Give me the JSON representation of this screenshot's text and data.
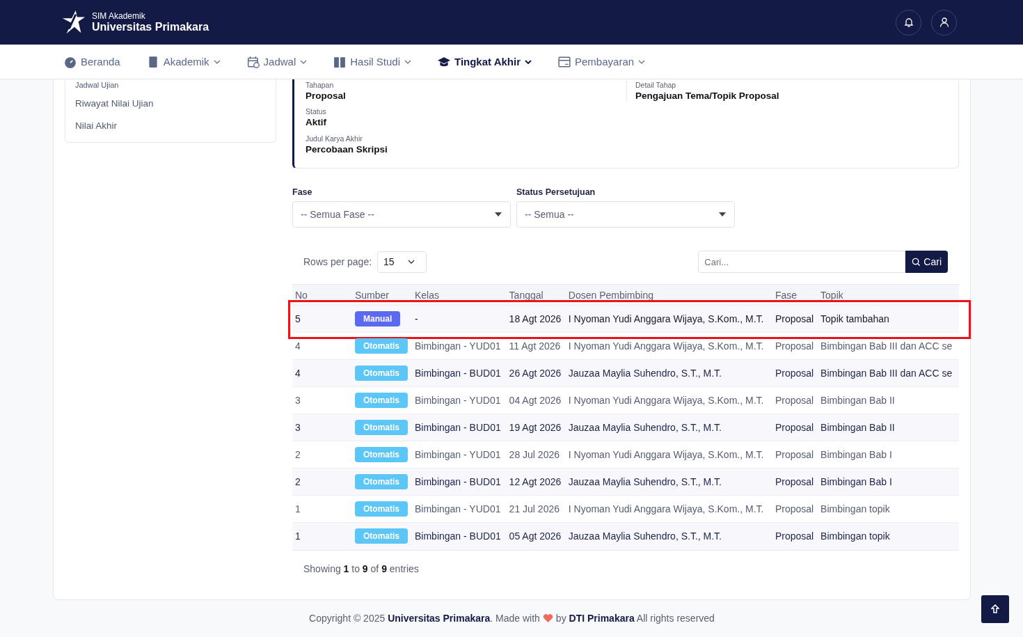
{
  "header": {
    "subtitle": "SIM Akademik",
    "title": "Universitas Primakara"
  },
  "nav": [
    {
      "label": "Beranda",
      "dropdown": false,
      "selected": false
    },
    {
      "label": "Akademik",
      "dropdown": true,
      "selected": false
    },
    {
      "label": "Jadwal",
      "dropdown": true,
      "selected": false
    },
    {
      "label": "Hasil Studi",
      "dropdown": true,
      "selected": false
    },
    {
      "label": "Tingkat Akhir",
      "dropdown": true,
      "selected": true
    },
    {
      "label": "Pembayaran",
      "dropdown": true,
      "selected": false
    }
  ],
  "sidebar": {
    "items": [
      "Jadwal Ujian",
      "Riwayat Nilai Ujian",
      "Nilai Akhir"
    ]
  },
  "info": {
    "fields": [
      {
        "label": "Tahapan",
        "value": "Proposal"
      },
      {
        "label": "Detail Tahap",
        "value": "Pengajuan Tema/Topik Proposal"
      },
      {
        "label": "Status",
        "value": "Aktif"
      },
      {
        "label": "Judul Karya Akhir",
        "value": "Percobaan Skripsi"
      }
    ]
  },
  "filters": [
    {
      "label": "Fase",
      "value": "-- Semua Fase --"
    },
    {
      "label": "Status Persetujuan",
      "value": "-- Semua --"
    }
  ],
  "rows_per_page": {
    "label": "Rows per page:",
    "value": "15"
  },
  "search": {
    "placeholder": "Cari...",
    "button": "Cari"
  },
  "table": {
    "columns": [
      "No",
      "Sumber",
      "Kelas",
      "Tanggal",
      "Dosen Pembimbing",
      "Fase",
      "Topik"
    ],
    "rows": [
      {
        "no": "5",
        "source": {
          "label": "Manual",
          "kind": "manual"
        },
        "kelas": "-",
        "tanggal": "18 Agt 2026",
        "dosen": "I Nyoman Yudi Anggara Wijaya, S.Kom., M.T.",
        "fase": "Proposal",
        "topik": "Topik tambahan",
        "highlighted": true
      },
      {
        "no": "4",
        "source": {
          "label": "Otomatis",
          "kind": "auto"
        },
        "kelas": "Bimbingan - YUD01",
        "tanggal": "11 Agt 2026",
        "dosen": "I Nyoman Yudi Anggara Wijaya, S.Kom., M.T.",
        "fase": "Proposal",
        "topik": "Bimbingan Bab III dan ACC se",
        "highlighted": false
      },
      {
        "no": "4",
        "source": {
          "label": "Otomatis",
          "kind": "auto"
        },
        "kelas": "Bimbingan - BUD01",
        "tanggal": "26 Agt 2026",
        "dosen": "Jauzaa Maylia Suhendro, S.T., M.T.",
        "fase": "Proposal",
        "topik": "Bimbingan Bab III dan ACC se",
        "highlighted": false
      },
      {
        "no": "3",
        "source": {
          "label": "Otomatis",
          "kind": "auto"
        },
        "kelas": "Bimbingan - YUD01",
        "tanggal": "04 Agt 2026",
        "dosen": "I Nyoman Yudi Anggara Wijaya, S.Kom., M.T.",
        "fase": "Proposal",
        "topik": "Bimbingan Bab II",
        "highlighted": false
      },
      {
        "no": "3",
        "source": {
          "label": "Otomatis",
          "kind": "auto"
        },
        "kelas": "Bimbingan - BUD01",
        "tanggal": "19 Agt 2026",
        "dosen": "Jauzaa Maylia Suhendro, S.T., M.T.",
        "fase": "Proposal",
        "topik": "Bimbingan Bab II",
        "highlighted": false
      },
      {
        "no": "2",
        "source": {
          "label": "Otomatis",
          "kind": "auto"
        },
        "kelas": "Bimbingan - YUD01",
        "tanggal": "28 Jul 2026",
        "dosen": "I Nyoman Yudi Anggara Wijaya, S.Kom., M.T.",
        "fase": "Proposal",
        "topik": "Bimbingan Bab I",
        "highlighted": false
      },
      {
        "no": "2",
        "source": {
          "label": "Otomatis",
          "kind": "auto"
        },
        "kelas": "Bimbingan - BUD01",
        "tanggal": "12 Agt 2026",
        "dosen": "Jauzaa Maylia Suhendro, S.T., M.T.",
        "fase": "Proposal",
        "topik": "Bimbingan Bab I",
        "highlighted": false
      },
      {
        "no": "1",
        "source": {
          "label": "Otomatis",
          "kind": "auto"
        },
        "kelas": "Bimbingan - YUD01",
        "tanggal": "21 Jul 2026",
        "dosen": "I Nyoman Yudi Anggara Wijaya, S.Kom., M.T.",
        "fase": "Proposal",
        "topik": "Bimbingan topik",
        "highlighted": false
      },
      {
        "no": "1",
        "source": {
          "label": "Otomatis",
          "kind": "auto"
        },
        "kelas": "Bimbingan - BUD01",
        "tanggal": "05 Agt 2026",
        "dosen": "Jauzaa Maylia Suhendro, S.T., M.T.",
        "fase": "Proposal",
        "topik": "Bimbingan topik",
        "highlighted": false
      }
    ]
  },
  "showing": "Showing **1** to **9** of **9** entries",
  "footer": {
    "before": "Copyright © 2025 **Universitas Primakara**. Made with",
    "after": "by **DTI Primakara** All rights reserved"
  }
}
